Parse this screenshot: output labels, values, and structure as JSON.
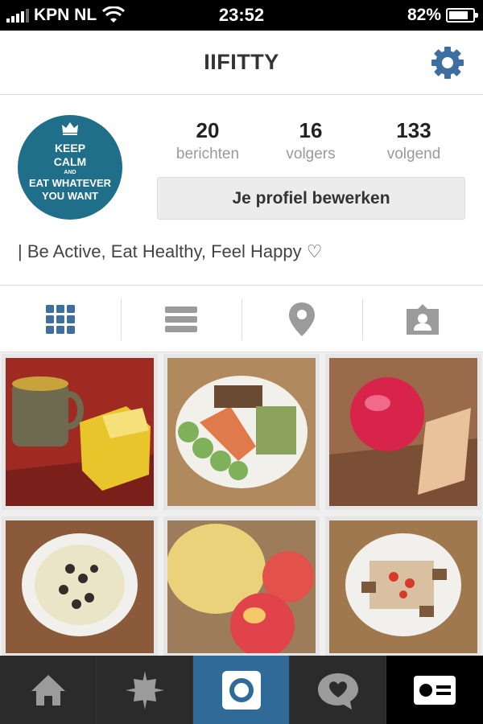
{
  "status_bar": {
    "carrier": "KPN NL",
    "time": "23:52",
    "battery_text": "82%",
    "battery_level": 0.82
  },
  "navbar": {
    "title": "IIFITTY",
    "settings_icon": "gear-icon"
  },
  "profile": {
    "avatar_text": [
      "KEEP",
      "CALM",
      "AND",
      "EAT WHATEVER",
      "YOU WANT"
    ],
    "stats": [
      {
        "number": "20",
        "label": "berichten"
      },
      {
        "number": "16",
        "label": "volgers"
      },
      {
        "number": "133",
        "label": "volgend"
      }
    ],
    "edit_button": "Je profiel bewerken",
    "bio": "| Be Active, Eat Healthy, Feel Happy ♡"
  },
  "view_tabs": [
    {
      "icon": "grid-icon",
      "active": true
    },
    {
      "icon": "list-icon",
      "active": false
    },
    {
      "icon": "location-pin-icon",
      "active": false
    },
    {
      "icon": "tagged-person-icon",
      "active": false
    }
  ],
  "photos": [
    {
      "subject": "tea-and-butter"
    },
    {
      "subject": "salmon-salad"
    },
    {
      "subject": "apple-and-crackers"
    },
    {
      "subject": "fruit-bowl"
    },
    {
      "subject": "melon-and-apples"
    },
    {
      "subject": "croutons-salad"
    }
  ],
  "bottom_tabs": [
    {
      "icon": "home-icon"
    },
    {
      "icon": "explore-star-icon"
    },
    {
      "icon": "camera-icon",
      "active": true
    },
    {
      "icon": "activity-speech-heart-icon"
    },
    {
      "icon": "profile-card-icon"
    }
  ],
  "colors": {
    "accent": "#3e6fa0",
    "camera_tab": "#2f6a99",
    "avatar_bg": "#1f6f8b",
    "tab_inactive": "#9b9b9b"
  }
}
